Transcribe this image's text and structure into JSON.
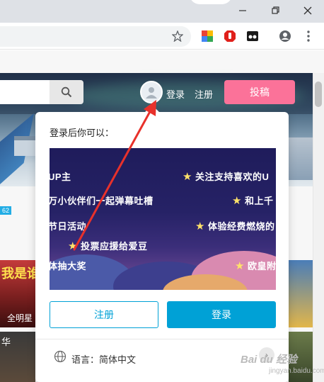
{
  "browser": {
    "window_controls": [
      "minimize",
      "maximize",
      "close"
    ],
    "toolbar_icons": [
      "star-icon",
      "photos-extension-icon",
      "adblock-extension-icon",
      "extension-icon",
      "account-icon",
      "menu-icon"
    ]
  },
  "site_header": {
    "login_link": "登录",
    "register_link": "注册",
    "upload_button": "投稿"
  },
  "popup": {
    "title": "登录后你可以：",
    "promo_lines": [
      "UP主",
      "关注支持喜欢的U",
      "万小伙伴们一起弹幕吐槽",
      "和上千",
      "节日活动",
      "体验经费燃烧的",
      "投票应援给爱豆",
      "体抽大奖",
      "欧皇附体"
    ],
    "register_button": "注册",
    "login_button": "登录",
    "language_label": "语言：简体中文"
  },
  "background": {
    "badge": "62",
    "thumb1_text": "我是谁",
    "thumb1_label": "全明星",
    "thumb2_text": "华"
  },
  "watermark": {
    "text": "Bai du 经验",
    "sub": "jingyan.baidu.com"
  },
  "colors": {
    "accent_blue": "#00a1d6",
    "upload_pink": "#fb7299",
    "annotation_red": "#e8312b"
  }
}
